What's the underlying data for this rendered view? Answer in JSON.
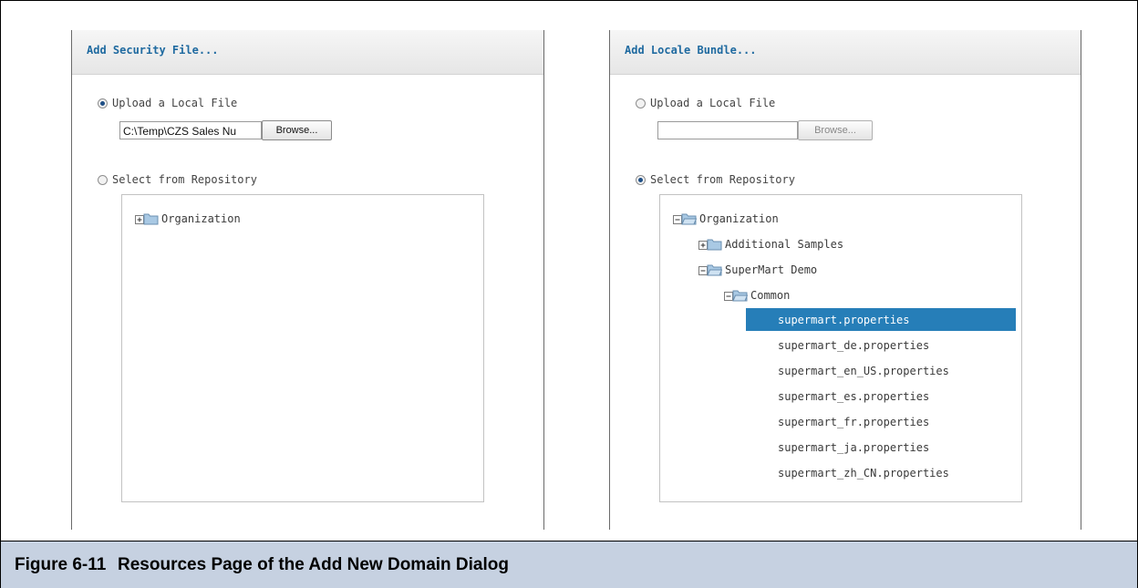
{
  "security_panel": {
    "title": "Add Security File...",
    "upload_option": {
      "label": "Upload a Local File",
      "checked": true
    },
    "file_input_value": "C:\\Temp\\CZS Sales Nu",
    "browse_label": "Browse...",
    "repository_option": {
      "label": "Select from Repository",
      "checked": false
    },
    "tree": [
      {
        "label": "Organization",
        "expander": "plus",
        "icon": "folder-collapsed-icon"
      }
    ]
  },
  "locale_panel": {
    "title": "Add Locale Bundle...",
    "upload_option": {
      "label": "Upload a Local File",
      "checked": false
    },
    "file_input_value": "",
    "browse_label": "Browse...",
    "repository_option": {
      "label": "Select from Repository",
      "checked": true
    },
    "tree": [
      {
        "label": "Organization",
        "expander": "minus",
        "icon": "folder-expanded-icon"
      },
      {
        "label": "Additional Samples",
        "expander": "plus",
        "icon": "folder-collapsed-icon"
      },
      {
        "label": "SuperMart Demo",
        "expander": "minus",
        "icon": "folder-expanded-icon"
      },
      {
        "label": "Common",
        "expander": "minus",
        "icon": "folder-expanded-icon"
      }
    ],
    "files": [
      {
        "label": "supermart.properties",
        "selected": true
      },
      {
        "label": "supermart_de.properties",
        "selected": false
      },
      {
        "label": "supermart_en_US.properties",
        "selected": false
      },
      {
        "label": "supermart_es.properties",
        "selected": false
      },
      {
        "label": "supermart_fr.properties",
        "selected": false
      },
      {
        "label": "supermart_ja.properties",
        "selected": false
      },
      {
        "label": "supermart_zh_CN.properties",
        "selected": false
      }
    ]
  },
  "caption": {
    "number": "Figure 6-11",
    "text": "Resources Page of the Add New Domain Dialog"
  },
  "colors": {
    "title_text": "#1f6aa0",
    "selection_bg": "#267eb8",
    "caption_bg": "#c6d1e1"
  }
}
